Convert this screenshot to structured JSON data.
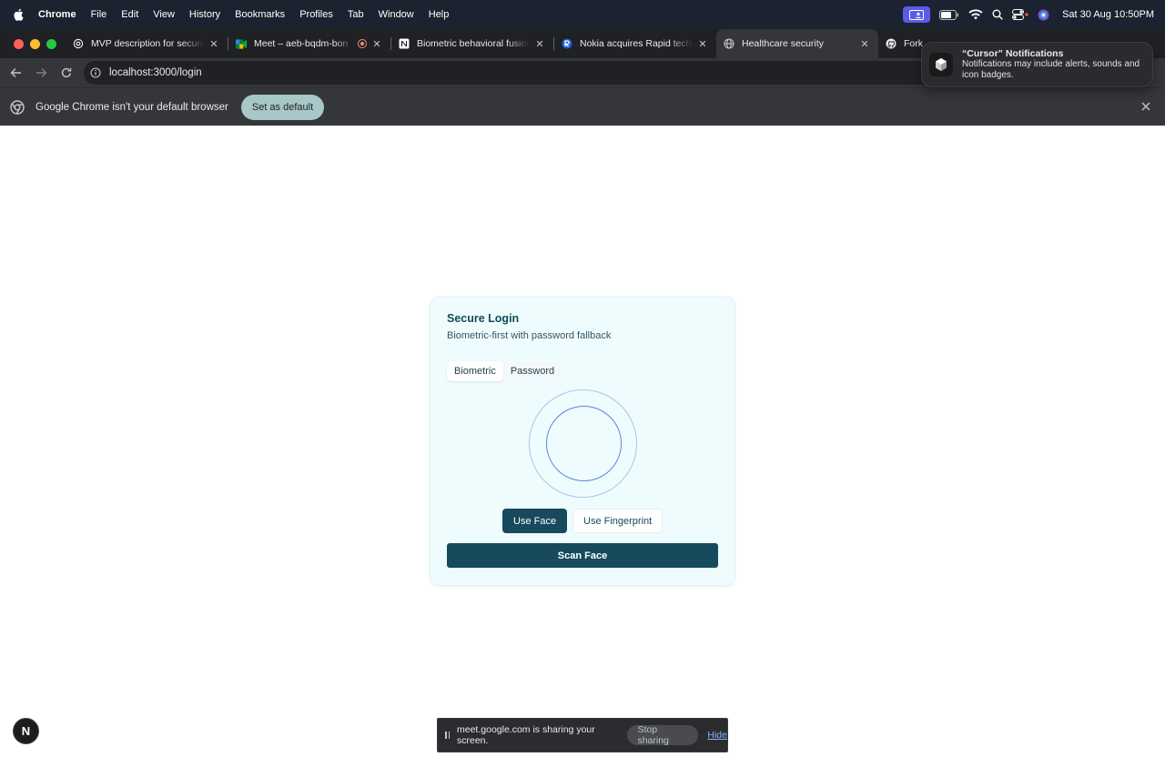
{
  "menubar": {
    "app_name": "Chrome",
    "items": [
      "File",
      "Edit",
      "View",
      "History",
      "Bookmarks",
      "Profiles",
      "Tab",
      "Window",
      "Help"
    ],
    "clock": "Sat 30 Aug  10:50PM"
  },
  "tabs": [
    {
      "title": "MVP description for security",
      "icon": "openai-icon",
      "active": false
    },
    {
      "title": "Meet – aeb-bqdm-bon",
      "icon": "google-meet-icon",
      "active": false,
      "recording": true
    },
    {
      "title": "Biometric behavioral fusion",
      "icon": "notion-icon",
      "active": false
    },
    {
      "title": "Nokia acquires Rapid technol",
      "icon": "rapid-icon",
      "active": false
    },
    {
      "title": "Healthcare security",
      "icon": "globe-icon",
      "active": true
    },
    {
      "title": "Fork a",
      "icon": "github-icon",
      "active": false
    }
  ],
  "toolbar": {
    "url": "localhost:3000/login"
  },
  "infobar": {
    "message": "Google Chrome isn't your default browser",
    "button_label": "Set as default"
  },
  "notification": {
    "title": "“Cursor” Notifications",
    "body": "Notifications may include alerts, sounds and icon badges."
  },
  "login": {
    "title": "Secure Login",
    "subtitle": "Biometric-first with password fallback",
    "tabs": [
      {
        "label": "Biometric",
        "selected": true
      },
      {
        "label": "Password",
        "selected": false
      }
    ],
    "face_button": "Use Face",
    "fingerprint_button": "Use Fingerprint",
    "scan_button": "Scan Face"
  },
  "dev_indicator": {
    "label": "N"
  },
  "screen_share": {
    "message": "meet.google.com is sharing your screen.",
    "stop_label": "Stop sharing",
    "hide_label": "Hide"
  },
  "colors": {
    "primary": "#164a5c",
    "card_bg": "#effcfd",
    "ring_outer": "#a6c6ee",
    "ring_inner": "#5e85df"
  }
}
